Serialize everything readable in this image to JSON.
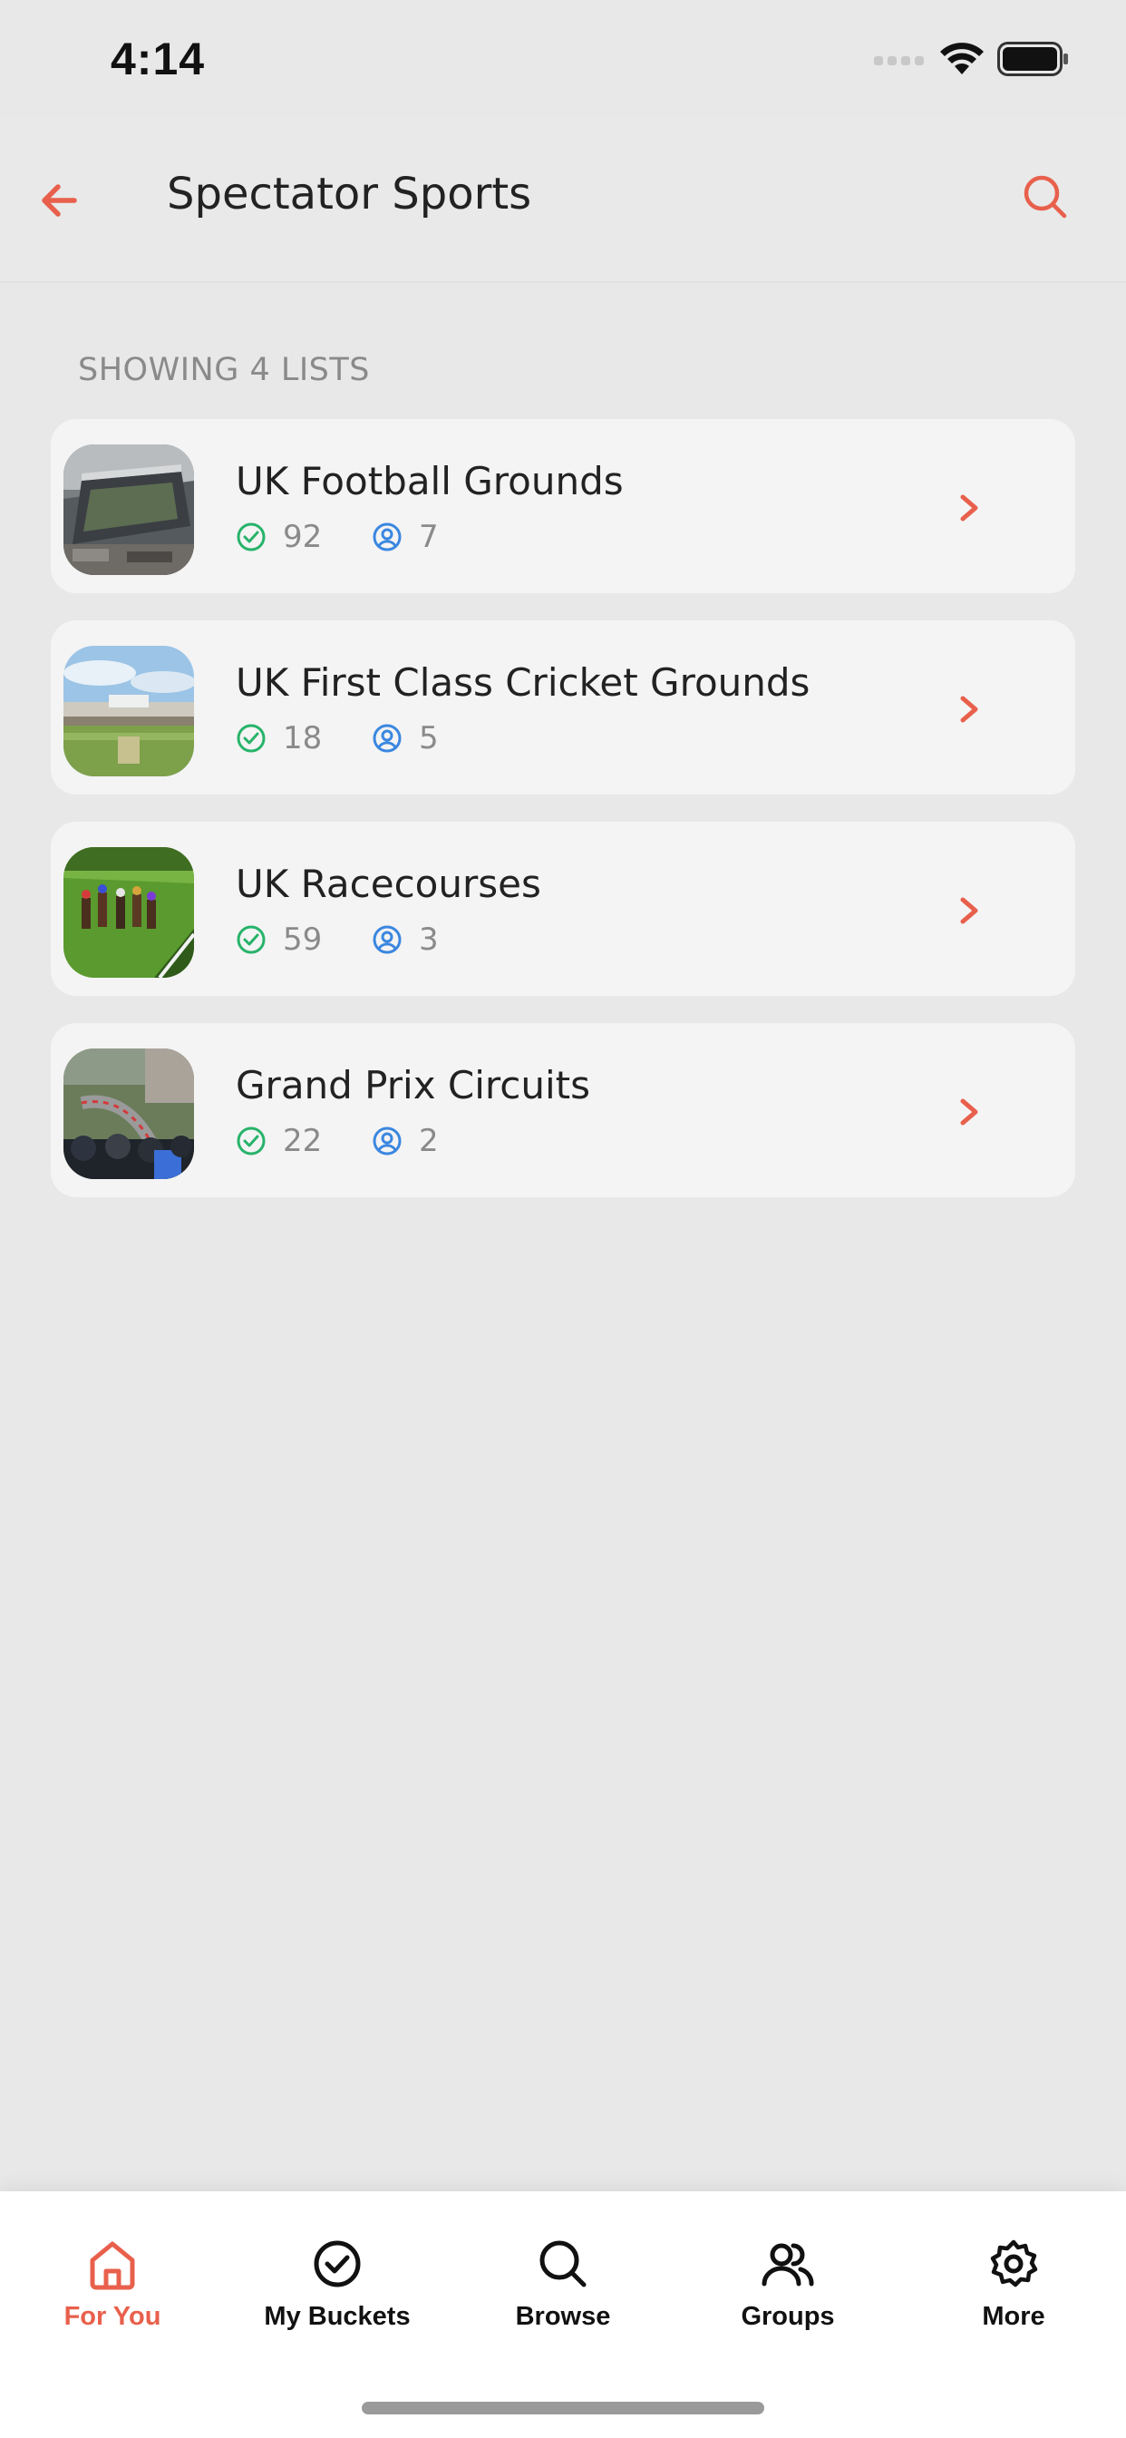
{
  "status_bar": {
    "time": "4:14",
    "icons": [
      "signal-icon",
      "wifi-icon",
      "battery-icon"
    ]
  },
  "header": {
    "title": "Spectator Sports",
    "back_icon": "back-arrow-icon",
    "search_icon": "search-icon"
  },
  "list_count": "SHOWING 4 LISTS",
  "lists": [
    {
      "title": "UK Football Grounds",
      "completed": "92",
      "members": "7",
      "image": "stadium-photo"
    },
    {
      "title": "UK First Class Cricket Grounds",
      "completed": "18",
      "members": "5",
      "image": "cricket-ground-photo"
    },
    {
      "title": "UK Racecourses",
      "completed": "59",
      "members": "3",
      "image": "horse-racing-photo"
    },
    {
      "title": "Grand Prix Circuits",
      "completed": "22",
      "members": "2",
      "image": "race-circuit-photo"
    }
  ],
  "tabs": [
    {
      "label": "For You",
      "icon": "home-icon",
      "active": true
    },
    {
      "label": "My Buckets",
      "icon": "check-circle-icon",
      "active": false
    },
    {
      "label": "Browse",
      "icon": "search-icon",
      "active": false
    },
    {
      "label": "Groups",
      "icon": "users-icon",
      "active": false
    },
    {
      "label": "More",
      "icon": "gear-icon",
      "active": false
    }
  ],
  "colors": {
    "accent": "#e8604c",
    "completed_green": "#27b36a",
    "members_blue": "#3b87e0",
    "background": "#e8e8e8",
    "card": "#f4f4f4"
  }
}
